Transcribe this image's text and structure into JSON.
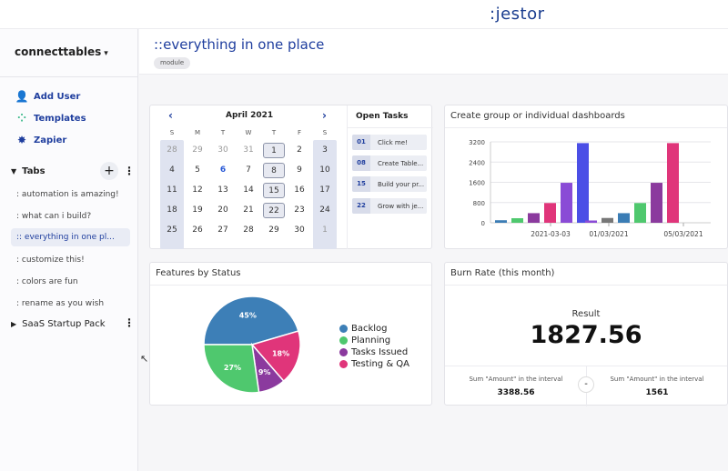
{
  "app": {
    "logo": ":jestor"
  },
  "sidebar": {
    "workspace": "connecttables",
    "actions": [
      {
        "label": "Add User",
        "icon": "add-user-icon"
      },
      {
        "label": "Templates",
        "icon": "templates-icon"
      },
      {
        "label": "Zapier",
        "icon": "zapier-icon"
      }
    ],
    "tabs_label": "Tabs",
    "tabs": [
      ": automation is amazing!",
      ": what can i build?",
      ":: everything in one pl...",
      ": customize this!",
      ": colors are fun",
      ": rename as you wish"
    ],
    "active_tab": 2,
    "pack_label": "SaaS Startup Pack"
  },
  "page": {
    "title": "::everything in one place",
    "badge": "module"
  },
  "calendar": {
    "month": "April 2021",
    "dow": [
      "S",
      "M",
      "T",
      "W",
      "T",
      "F",
      "S"
    ],
    "weeks": [
      [
        "28",
        "29",
        "30",
        "31",
        "1",
        "2",
        "3"
      ],
      [
        "4",
        "5",
        "6",
        "7",
        "8",
        "9",
        "10"
      ],
      [
        "11",
        "12",
        "13",
        "14",
        "15",
        "16",
        "17"
      ],
      [
        "18",
        "19",
        "20",
        "21",
        "22",
        "23",
        "24"
      ],
      [
        "25",
        "26",
        "27",
        "28",
        "29",
        "30",
        "1"
      ]
    ],
    "today": "6"
  },
  "open_tasks": {
    "title": "Open Tasks",
    "items": [
      {
        "num": "01",
        "label": "Click me!"
      },
      {
        "num": "08",
        "label": "Create Table..."
      },
      {
        "num": "15",
        "label": "Build your pr..."
      },
      {
        "num": "22",
        "label": "Grow with je..."
      }
    ]
  },
  "dashboards": {
    "title": "Create group or individual dashboards",
    "chart_data": {
      "type": "bar",
      "ylim": [
        0,
        3200
      ],
      "yticks": [
        "0",
        "800",
        "1600",
        "2400",
        "3200"
      ],
      "xticks": [
        "2021-03-03",
        "01/03/2021",
        "05/03/2021"
      ],
      "groups": [
        {
          "values": [
            100,
            180,
            380,
            780,
            1580,
            3150
          ],
          "colors": [
            "#3b7db5",
            "#4fc86e",
            "#8b3a9e",
            "#e0357a",
            "#8a4bd6",
            "#4b4fe6"
          ]
        },
        {
          "values": [
            90,
            190,
            380,
            780,
            1580,
            3150
          ],
          "colors": [
            "#8a4bd6",
            "#777777",
            "#3b7db5",
            "#4fc86e",
            "#8b3a9e",
            "#e0357a"
          ]
        }
      ]
    }
  },
  "features": {
    "title": "Features by Status",
    "chart_data": {
      "type": "pie",
      "slices": [
        {
          "name": "Backlog",
          "value": 45,
          "label": "45%",
          "color": "#3d7fb7"
        },
        {
          "name": "Testing & QA",
          "value": 18,
          "label": "18%",
          "color": "#e0357a"
        },
        {
          "name": "Tasks Issued",
          "value": 9,
          "label": "9%",
          "color": "#8b3a9e"
        },
        {
          "name": "Planning",
          "value": 27,
          "label": "27%",
          "color": "#4fc86e"
        }
      ],
      "legend": [
        "Backlog",
        "Planning",
        "Tasks Issued",
        "Testing & QA"
      ],
      "legend_colors": [
        "#3d7fb7",
        "#4fc86e",
        "#8b3a9e",
        "#e0357a"
      ]
    }
  },
  "burn": {
    "title": "Burn Rate (this month)",
    "result_label": "Result",
    "result_value": "1827.56",
    "left_label": "Sum \"Amount\" in the interval",
    "left_value": "3388.56",
    "right_label": "Sum \"Amount\" in the interval",
    "right_value": "1561",
    "op": "-"
  }
}
